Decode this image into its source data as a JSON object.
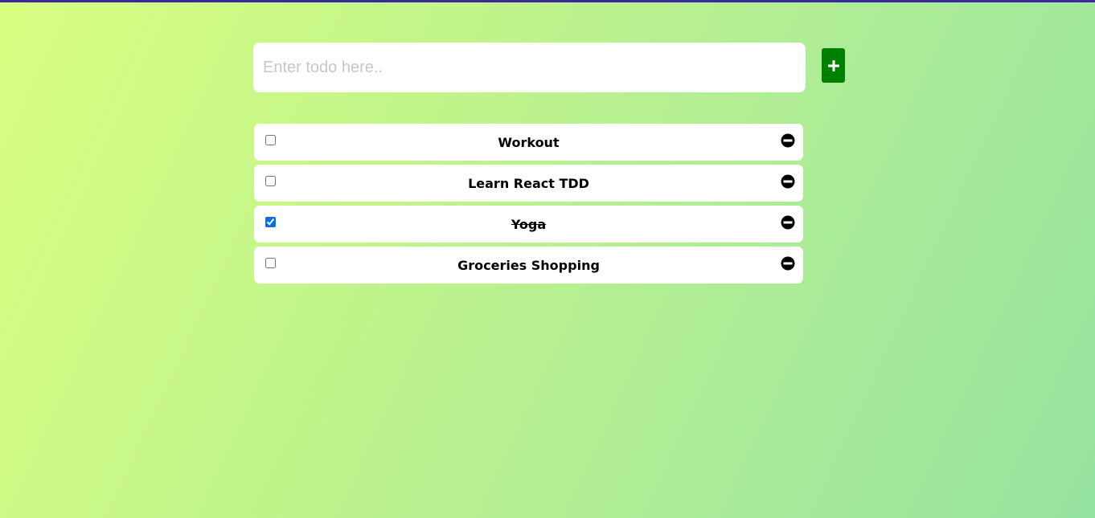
{
  "input": {
    "placeholder": "Enter todo here..",
    "value": ""
  },
  "add_button": {
    "icon": "plus-icon",
    "color": "#008000"
  },
  "todos": [
    {
      "text": "Workout",
      "completed": false
    },
    {
      "text": "Learn React TDD",
      "completed": false
    },
    {
      "text": "Yoga",
      "completed": true
    },
    {
      "text": "Groceries Shopping",
      "completed": false
    }
  ],
  "remove_icon": "minus-circle-icon",
  "colors": {
    "top_border": "#3a2a9e",
    "gradient_start": "#d8fe80",
    "gradient_end": "#96e4a0",
    "checkbox_accent": "#0a6ee6"
  }
}
